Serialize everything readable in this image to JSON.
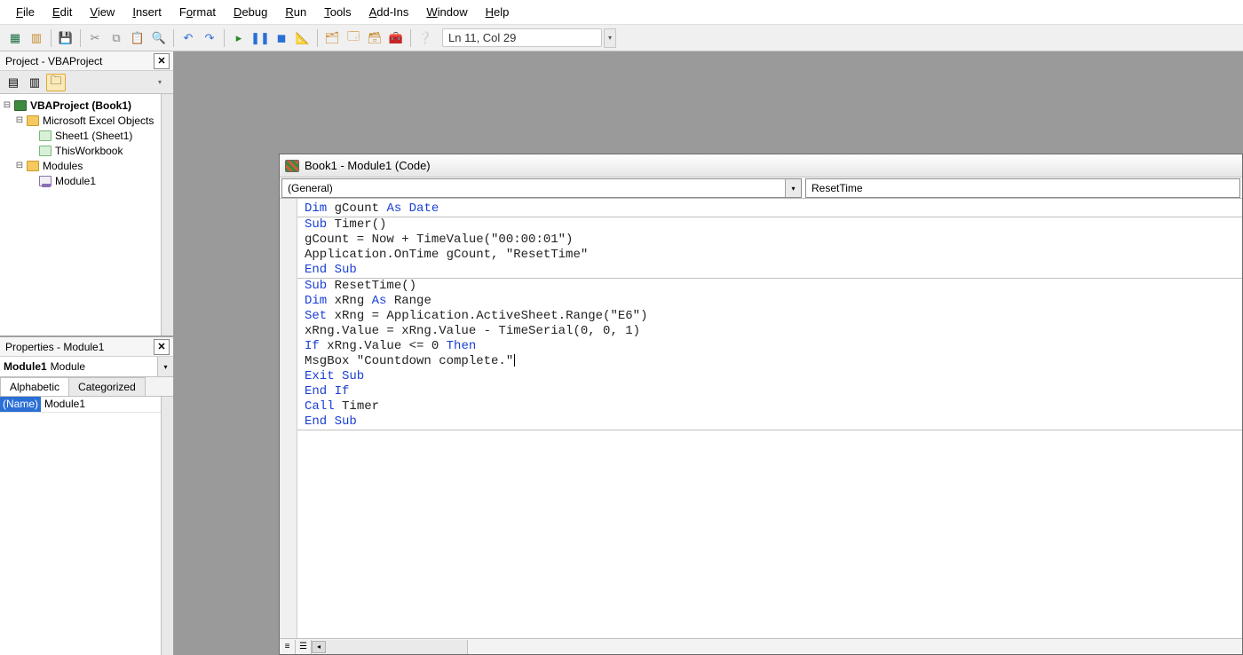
{
  "menu": {
    "items": [
      {
        "u": "F",
        "rest": "ile"
      },
      {
        "u": "E",
        "rest": "dit"
      },
      {
        "u": "V",
        "rest": "iew"
      },
      {
        "u": "I",
        "rest": "nsert"
      },
      {
        "u": "",
        "rest": "F",
        "u2": "o",
        "rest2": "rmat"
      },
      {
        "u": "D",
        "rest": "ebug"
      },
      {
        "u": "R",
        "rest": "un"
      },
      {
        "u": "T",
        "rest": "ools"
      },
      {
        "u": "A",
        "rest": "dd-Ins"
      },
      {
        "u": "W",
        "rest": "indow"
      },
      {
        "u": "H",
        "rest": "elp"
      }
    ]
  },
  "toolbar": {
    "lncol": "Ln 11, Col 29"
  },
  "project_panel": {
    "title": "Project - VBAProject",
    "tree": {
      "root": "VBAProject (Book1)",
      "folder1": "Microsoft Excel Objects",
      "sheet1": "Sheet1 (Sheet1)",
      "thiswb": "ThisWorkbook",
      "folder2": "Modules",
      "module1": "Module1"
    }
  },
  "properties_panel": {
    "title": "Properties - Module1",
    "combo_bold": "Module1",
    "combo_rest": "Module",
    "tabs": {
      "alpha": "Alphabetic",
      "cat": "Categorized"
    },
    "rows": [
      {
        "name": "(Name)",
        "value": "Module1"
      }
    ]
  },
  "code_window": {
    "title": "Book1 - Module1 (Code)",
    "left_combo": "(General)",
    "right_combo": "ResetTime",
    "lines": [
      [
        {
          "t": "Dim",
          "k": 1
        },
        {
          "t": " gCount "
        },
        {
          "t": "As",
          "k": 1
        },
        {
          "t": " "
        },
        {
          "t": "Date",
          "k": 1
        }
      ],
      [
        {
          "t": "Sub",
          "k": 1
        },
        {
          "t": " Timer()"
        }
      ],
      [
        {
          "t": "gCount = Now + TimeValue(\"00:00:01\")"
        }
      ],
      [
        {
          "t": "Application.OnTime gCount, \"ResetTime\""
        }
      ],
      [
        {
          "t": "End Sub",
          "k": 1
        }
      ],
      [
        {
          "t": "Sub",
          "k": 1
        },
        {
          "t": " ResetTime()"
        }
      ],
      [
        {
          "t": "Dim",
          "k": 1
        },
        {
          "t": " xRng "
        },
        {
          "t": "As",
          "k": 1
        },
        {
          "t": " Range"
        }
      ],
      [
        {
          "t": "Set",
          "k": 1
        },
        {
          "t": " xRng = Application.ActiveSheet.Range(\"E6\")"
        }
      ],
      [
        {
          "t": "xRng.Value = xRng.Value - TimeSerial(0, 0, 1)"
        }
      ],
      [
        {
          "t": "If",
          "k": 1
        },
        {
          "t": " xRng.Value <= 0 "
        },
        {
          "t": "Then",
          "k": 1
        }
      ],
      [
        {
          "t": "MsgBox \"Countdown complete.\""
        },
        {
          "caret": 1
        }
      ],
      [
        {
          "t": "Exit Sub",
          "k": 1
        }
      ],
      [
        {
          "t": "End If",
          "k": 1
        }
      ],
      [
        {
          "t": "Call",
          "k": 1
        },
        {
          "t": " Timer"
        }
      ],
      [
        {
          "t": "End Sub",
          "k": 1
        }
      ]
    ],
    "proc_seps_after": [
      0,
      4,
      14
    ]
  }
}
